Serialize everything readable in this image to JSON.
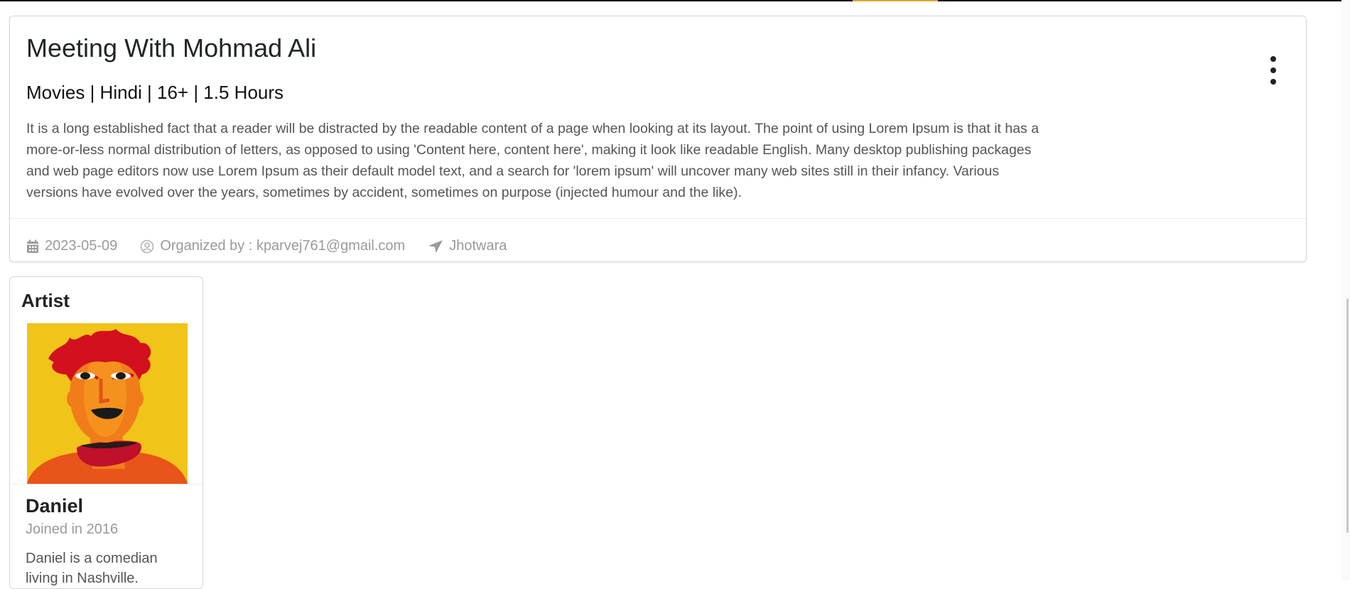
{
  "event": {
    "title": "Meeting With Mohmad Ali",
    "meta": "Movies | Hindi | 16+ | 1.5 Hours",
    "description": "It is a long established fact that a reader will be distracted by the readable content of a page when looking at its layout. The point of using Lorem Ipsum is that it has a more-or-less normal distribution of letters, as opposed to using 'Content here, content here', making it look like readable English. Many desktop publishing packages and web page editors now use Lorem Ipsum as their default model text, and a search for 'lorem ipsum' will uncover many web sites still in their infancy. Various versions have evolved over the years, sometimes by accident, sometimes on purpose (injected humour and the like).",
    "footer": {
      "date": "2023-05-09",
      "organizer": "Organized by : kparvej761@gmail.com",
      "location": "Jhotwara"
    },
    "icons": {
      "date": "calendar-icon",
      "organizer": "user-circle-icon",
      "location": "location-arrow-icon",
      "menu": "kebab-menu-icon"
    }
  },
  "artist": {
    "heading": "Artist",
    "name": "Daniel",
    "joined": "Joined in 2016",
    "bio": "Daniel is a comedian living in Nashville.",
    "photo_colors": {
      "background": "#f0c419",
      "skin": "#f07d1a",
      "hair": "#d3101e",
      "shirt": "#e8541a",
      "scarf": "#c0102a"
    }
  },
  "colors": {
    "muted_text": "#9a9a9a",
    "body_text": "#555555",
    "border": "#d6d6d6"
  }
}
